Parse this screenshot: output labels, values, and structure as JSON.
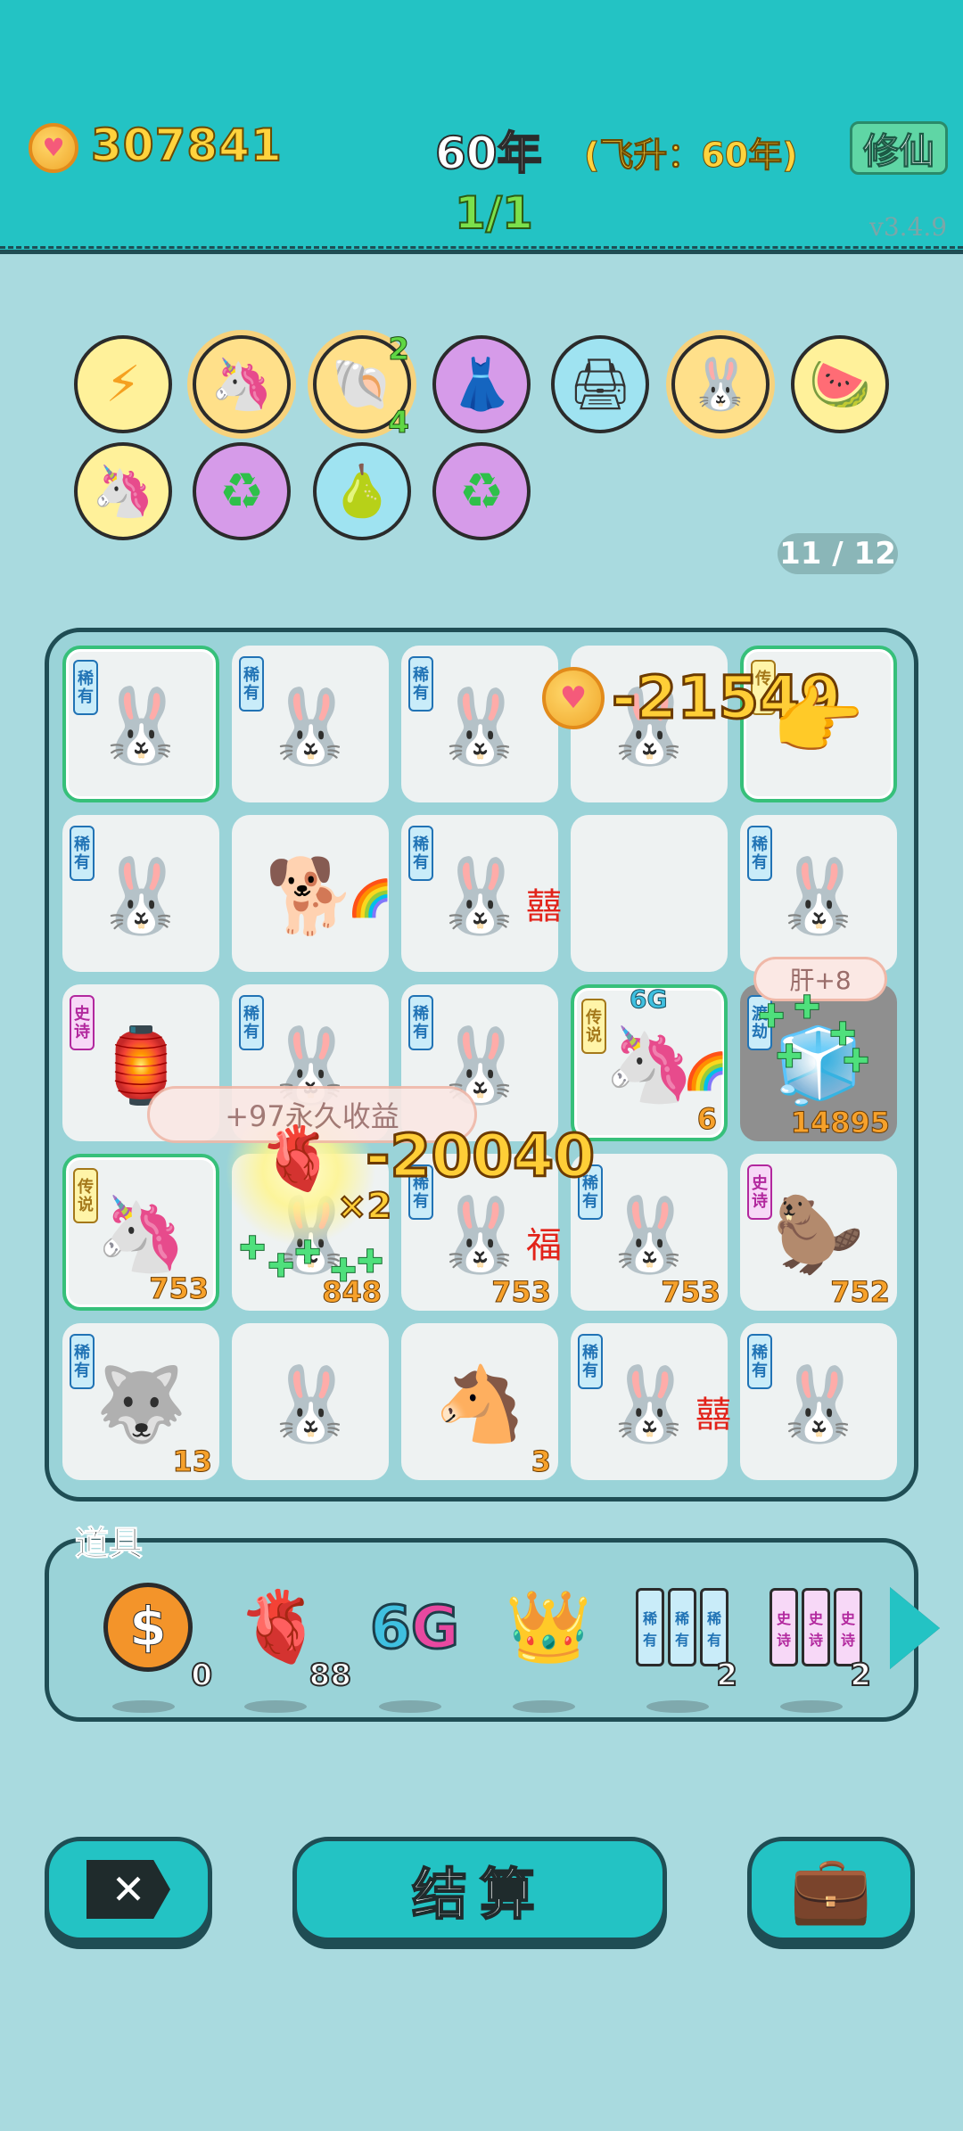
{
  "header": {
    "coins": "307841",
    "year": "60年",
    "ascend": "(飞升：60年)",
    "xiuxian_label": "修仙",
    "progress": "1/1",
    "version": "v3.4.9"
  },
  "effects": [
    {
      "name": "lightning-icon",
      "glyph": "⚡"
    },
    {
      "name": "unicorn-icon",
      "glyph": "🦄"
    },
    {
      "name": "shell-icon",
      "glyph": "🐚",
      "top": "2",
      "bottom": "4"
    },
    {
      "name": "skirt-icon",
      "glyph": "👗"
    },
    {
      "name": "printer-icon",
      "glyph": "🖨"
    },
    {
      "name": "rabbit-icon",
      "glyph": "🐰"
    },
    {
      "name": "fruit-plate-icon",
      "glyph": "🍉"
    },
    {
      "name": "unicorn-icon-2",
      "glyph": "🦄"
    },
    {
      "name": "recycle-icon",
      "glyph": "♻"
    },
    {
      "name": "pomelo-icon",
      "glyph": "🍐"
    },
    {
      "name": "recycle-icon-2",
      "glyph": "♻"
    }
  ],
  "slot_counter": "11 / 12",
  "board": {
    "tiles": [
      {
        "tag": "稀有",
        "tag_type": "rare",
        "sprite": "🐰",
        "num": "",
        "highlight": true
      },
      {
        "tag": "稀有",
        "tag_type": "rare",
        "sprite": "🐰",
        "num": ""
      },
      {
        "tag": "稀有",
        "tag_type": "rare",
        "sprite": "🐰",
        "num": ""
      },
      {
        "tag": "",
        "tag_type": "",
        "sprite": "🐰",
        "num": ""
      },
      {
        "tag": "传",
        "tag_type": "legend",
        "sprite": "",
        "num": "",
        "highlight": true
      },
      {
        "tag": "稀有",
        "tag_type": "rare",
        "sprite": "🐰",
        "num": ""
      },
      {
        "tag": "",
        "tag_type": "",
        "sprite": "🐕",
        "num": "",
        "deco": "🌈"
      },
      {
        "tag": "稀有",
        "tag_type": "rare",
        "sprite": "🐰",
        "num": "",
        "deco": "囍"
      },
      {
        "tag": "",
        "tag_type": "",
        "sprite": "",
        "num": ""
      },
      {
        "tag": "稀有",
        "tag_type": "rare",
        "sprite": "🐰",
        "num": ""
      },
      {
        "tag": "史诗",
        "tag_type": "epic",
        "sprite": "🏮",
        "num": ""
      },
      {
        "tag": "稀有",
        "tag_type": "rare",
        "sprite": "🐰",
        "num": ""
      },
      {
        "tag": "稀有",
        "tag_type": "rare",
        "sprite": "🐰",
        "num": ""
      },
      {
        "tag": "传说",
        "tag_type": "legend",
        "sprite": "🦄",
        "num": "6",
        "highlight": true,
        "deco": "🌈"
      },
      {
        "tag": "渡劫",
        "tag_type": "rare",
        "sprite": "🧊",
        "num": "14895",
        "dark": true
      },
      {
        "tag": "传说",
        "tag_type": "legend",
        "sprite": "🦄",
        "num": "753",
        "highlight": true
      },
      {
        "tag": "",
        "tag_type": "",
        "sprite": "🐰",
        "num": "848"
      },
      {
        "tag": "稀有",
        "tag_type": "rare",
        "sprite": "🐰",
        "num": "753",
        "deco": "福"
      },
      {
        "tag": "稀有",
        "tag_type": "rare",
        "sprite": "🐰",
        "num": "753"
      },
      {
        "tag": "史诗",
        "tag_type": "epic",
        "sprite": "🦫",
        "num": "752"
      },
      {
        "tag": "稀有",
        "tag_type": "rare",
        "sprite": "🐺",
        "num": "13"
      },
      {
        "tag": "",
        "tag_type": "",
        "sprite": "🐰",
        "num": ""
      },
      {
        "tag": "",
        "tag_type": "",
        "sprite": "🐴",
        "num": "3"
      },
      {
        "tag": "稀有",
        "tag_type": "rare",
        "sprite": "🐰",
        "num": "",
        "deco": "囍"
      },
      {
        "tag": "稀有",
        "tag_type": "rare",
        "sprite": "🐰",
        "num": ""
      }
    ]
  },
  "floating": {
    "coin_delta": "-21549",
    "liver_delta": "-20040",
    "multiplier": "×2",
    "permanent": "+97永久收益",
    "liver_plus": "肝+8",
    "g6": "6G"
  },
  "tools": {
    "title": "道具",
    "items": [
      {
        "name": "coin-tool",
        "count": "0"
      },
      {
        "name": "liver-tool",
        "count": "88"
      },
      {
        "name": "6g-tool",
        "count": "",
        "label": "6G"
      },
      {
        "name": "crown-tool",
        "count": ""
      },
      {
        "name": "rare-triple-tool",
        "count": "2",
        "cell": "稀有"
      },
      {
        "name": "epic-triple-tool",
        "count": "2",
        "cell": "史诗"
      }
    ]
  },
  "buttons": {
    "settle": "结算"
  }
}
